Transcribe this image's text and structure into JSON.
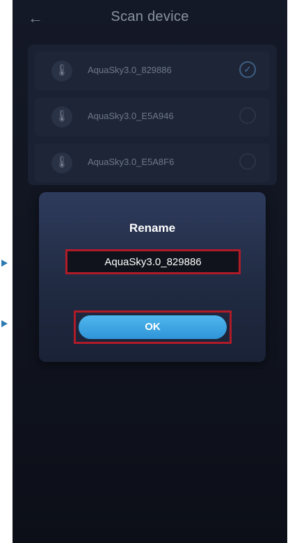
{
  "header": {
    "back_icon": "arrow-left-icon",
    "title": "Scan device"
  },
  "devices": [
    {
      "name": "AquaSky3.0_829886",
      "icon": "thermometer-icon",
      "selected": true
    },
    {
      "name": "AquaSky3.0_E5A946",
      "icon": "thermometer-icon",
      "selected": false
    },
    {
      "name": "AquaSky3.0_E5A8F6",
      "icon": "thermometer-icon",
      "selected": false
    }
  ],
  "dialog": {
    "title": "Rename",
    "input_value": "AquaSky3.0_829886",
    "ok_label": "OK"
  },
  "colors": {
    "background": "#141927",
    "dialog": "#2e3b5c",
    "ok_button": "#3aa6e6",
    "highlight_frame": "#b01b28",
    "pointer": "#2d7ab0"
  }
}
